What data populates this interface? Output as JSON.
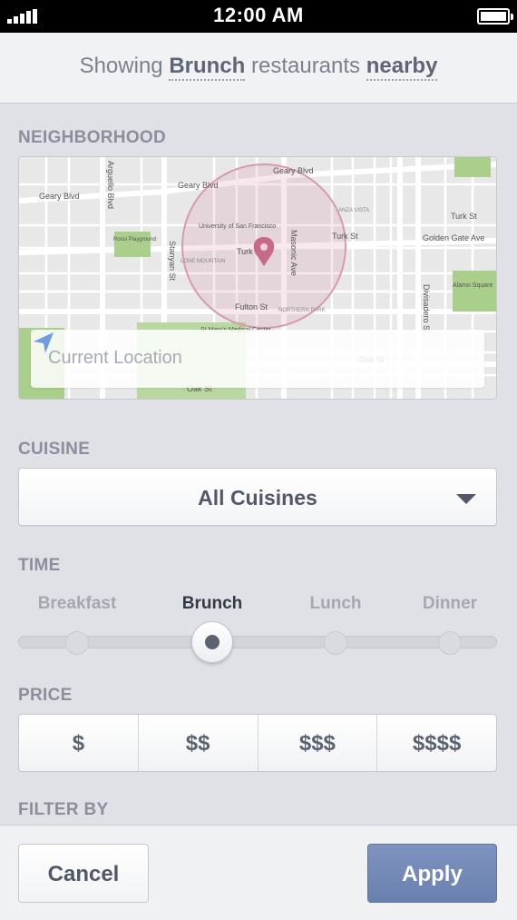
{
  "status_bar": {
    "time": "12:00 AM"
  },
  "header": {
    "prefix": "Showing",
    "category": "Brunch",
    "middle": "restaurants",
    "location": "nearby"
  },
  "neighborhood": {
    "label": "NEIGHBORHOOD",
    "location_placeholder": "Current Location",
    "map_labels": {
      "geary_blvd": "Geary Blvd",
      "turk_st": "Turk St",
      "golden_gate_ave": "Golden Gate Ave",
      "fulton_st": "Fulton St",
      "oak_st": "Oak St",
      "masonic_ave": "Masonic Ave",
      "stanyan_st": "Stanyan St",
      "arguello_blvd": "Arguello Blvd",
      "divisadero_st": "Divisadero St",
      "usf": "University of San Francisco",
      "st_marys": "St Mary's Medical Center",
      "rossi": "Rossi Playground",
      "alamo": "Alamo Square",
      "lone_mountain": "LONE MOUNTAIN",
      "northern_park": "NORTHERN PARK",
      "anza_vista": "ANZA VISTA"
    }
  },
  "cuisine": {
    "label": "CUISINE",
    "selected": "All Cuisines"
  },
  "time": {
    "label": "TIME",
    "options": [
      "Breakfast",
      "Brunch",
      "Lunch",
      "Dinner"
    ],
    "selected_index": 1
  },
  "price": {
    "label": "PRICE",
    "options": [
      "$",
      "$$",
      "$$$",
      "$$$$"
    ]
  },
  "filter_by": {
    "label": "FILTER BY"
  },
  "actions": {
    "cancel": "Cancel",
    "apply": "Apply"
  },
  "colors": {
    "accent": "#7286b4",
    "pin": "#c76a8a",
    "location_arrow": "#6f9de0"
  }
}
